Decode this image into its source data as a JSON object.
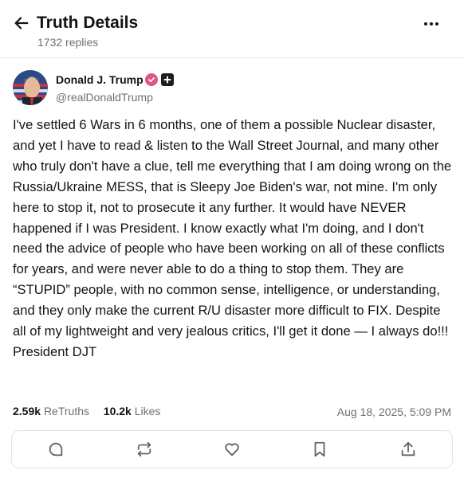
{
  "header": {
    "title": "Truth Details",
    "subtitle": "1732 replies"
  },
  "post": {
    "author_name": "Donald J. Trump",
    "handle": "@realDonaldTrump",
    "body": "I've settled 6 Wars in 6 months, one of them a possible Nuclear disaster, and yet I have to read & listen to the Wall Street Journal, and many other who truly don't have a clue, tell me everything that I am doing wrong on the Russia/Ukraine MESS, that is Sleepy Joe Biden's war, not mine. I'm only here to stop it, not to prosecute it any further. It would have NEVER happened if I was President. I know exactly what I'm doing, and I don't need the advice of people who have been working on all of these conflicts for years, and were never able to do a thing to stop them. They are “STUPID” people, with no common sense, intelligence, or understanding, and they only make the current R/U disaster more difficult to FIX. Despite all of my lightweight and very jealous critics, I'll get it done — I always do!!! President DJT",
    "retruths_count": "2.59k",
    "retruths_label": "ReTruths",
    "likes_count": "10.2k",
    "likes_label": "Likes",
    "timestamp": "Aug 18, 2025, 5:09 PM"
  },
  "icons": {
    "back": "arrow-left-icon",
    "more": "more-horizontal-icon",
    "verified": "verified-check-icon",
    "plus": "plus-badge-icon",
    "reply": "reply-bubble-icon",
    "retruth": "retruth-repeat-icon",
    "like": "heart-icon",
    "bookmark": "bookmark-icon",
    "share": "share-icon"
  },
  "colors": {
    "verified": "#e0567f",
    "muted_text": "#6b7078",
    "primary_text": "#111418"
  }
}
